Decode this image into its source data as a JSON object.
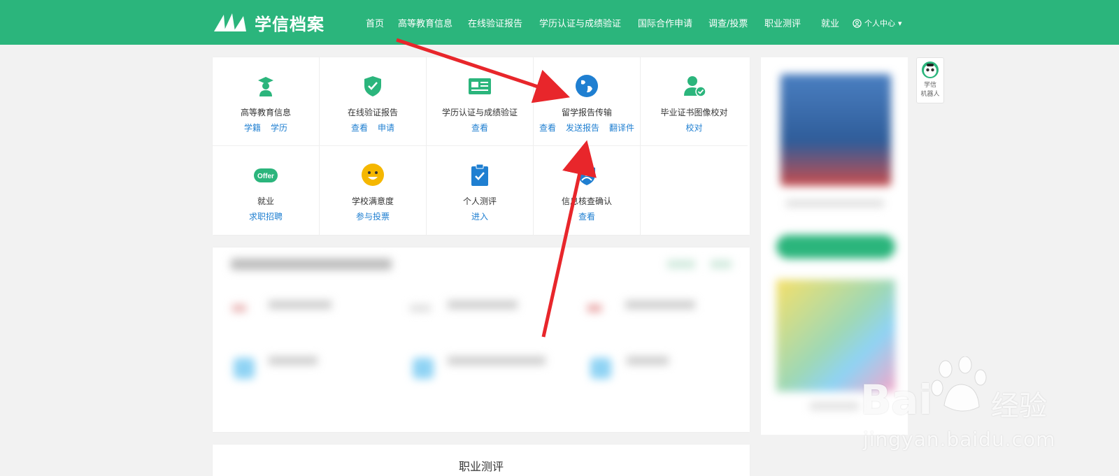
{
  "header": {
    "logo_text": "学信档案",
    "nav": [
      "首页",
      "高等教育信息",
      "在线验证报告",
      "学历认证与成绩验证",
      "国际合作申请",
      "调查/投票",
      "职业测评",
      "就业"
    ],
    "user_menu": "个人中心"
  },
  "services": [
    {
      "title": "高等教育信息",
      "links": [
        "学籍",
        "学历"
      ],
      "icon": "graduate-icon",
      "color": "#2bb57c"
    },
    {
      "title": "在线验证报告",
      "links": [
        "查看",
        "申请"
      ],
      "icon": "shield-check-icon",
      "color": "#2bb57c"
    },
    {
      "title": "学历认证与成绩验证",
      "links": [
        "查看"
      ],
      "icon": "id-card-icon",
      "color": "#2bb57c"
    },
    {
      "title": "留学报告传输",
      "links": [
        "查看",
        "发送报告",
        "翻译件"
      ],
      "icon": "globe-icon",
      "color": "#1f7fd1"
    },
    {
      "title": "毕业证书图像校对",
      "links": [
        "校对"
      ],
      "icon": "user-check-icon",
      "color": "#2bb57c"
    },
    {
      "title": "就业",
      "links": [
        "求职招聘"
      ],
      "icon": "offer-icon",
      "color": "#2bb57c",
      "badge": "Offer"
    },
    {
      "title": "学校满意度",
      "links": [
        "参与投票"
      ],
      "icon": "smile-icon",
      "color": "#f5b700"
    },
    {
      "title": "个人测评",
      "links": [
        "进入"
      ],
      "icon": "clipboard-icon",
      "color": "#1f7fd1"
    },
    {
      "title": "信息核查确认",
      "links": [
        "查看"
      ],
      "icon": "shield-user-icon",
      "color": "#1f7fd1"
    }
  ],
  "bottom_panel": {
    "title": "职业测评"
  },
  "robot": {
    "line1": "学信",
    "line2": "机器人"
  },
  "watermark": {
    "brand": "Bai",
    "cn": "经验",
    "url": "jingyan.baidu.com"
  }
}
